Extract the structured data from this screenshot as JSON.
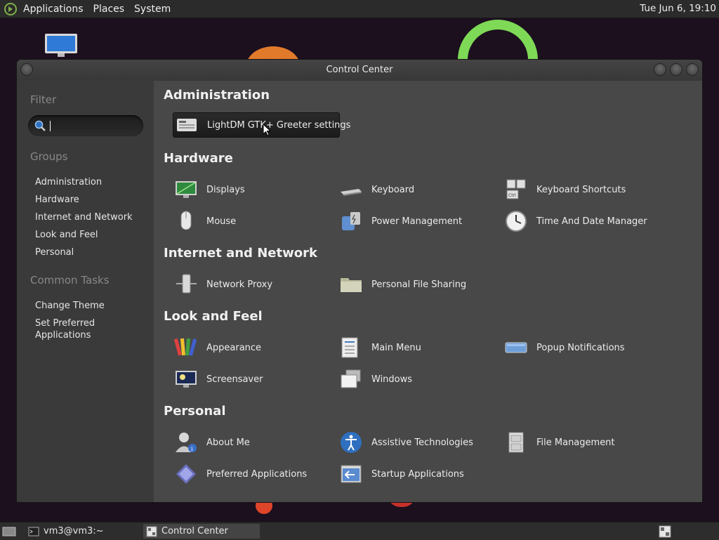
{
  "top_panel": {
    "menus": [
      "Applications",
      "Places",
      "System"
    ],
    "clock": "Tue Jun  6, 19:10"
  },
  "window": {
    "title": "Control Center"
  },
  "sidebar": {
    "filter_title": "Filter",
    "filter_value": "",
    "groups_title": "Groups",
    "groups": [
      "Administration",
      "Hardware",
      "Internet and Network",
      "Look and Feel",
      "Personal"
    ],
    "tasks_title": "Common Tasks",
    "tasks": [
      "Change Theme",
      "Set Preferred Applications"
    ]
  },
  "sections": {
    "administration": {
      "title": "Administration",
      "items": [
        "LightDM GTK+ Greeter settings"
      ]
    },
    "hardware": {
      "title": "Hardware",
      "items": [
        "Displays",
        "Keyboard",
        "Keyboard Shortcuts",
        "Mouse",
        "Power Management",
        "Time And Date Manager"
      ]
    },
    "internet": {
      "title": "Internet and Network",
      "items": [
        "Network Proxy",
        "Personal File Sharing"
      ]
    },
    "look": {
      "title": "Look and Feel",
      "items": [
        "Appearance",
        "Main Menu",
        "Popup Notifications",
        "Screensaver",
        "Windows"
      ]
    },
    "personal": {
      "title": "Personal",
      "items": [
        "About Me",
        "Assistive Technologies",
        "File Management",
        "Preferred Applications",
        "Startup Applications"
      ]
    }
  },
  "bottom_panel": {
    "tasks": [
      "vm3@vm3:~",
      "Control Center"
    ]
  },
  "icons": {
    "lightdm": "login-screen-icon",
    "displays": "monitor-icon",
    "keyboard": "keyboard-icon",
    "shortcuts": "keyboard-shortcuts-icon",
    "mouse": "mouse-icon",
    "power": "power-management-icon",
    "time": "clock-icon"
  },
  "colors": {
    "window_bg": "#484848",
    "sidebar_bg": "#3a3a3a",
    "panel_bg": "#2b2b2b",
    "accent_blue": "#3a7bd5"
  }
}
